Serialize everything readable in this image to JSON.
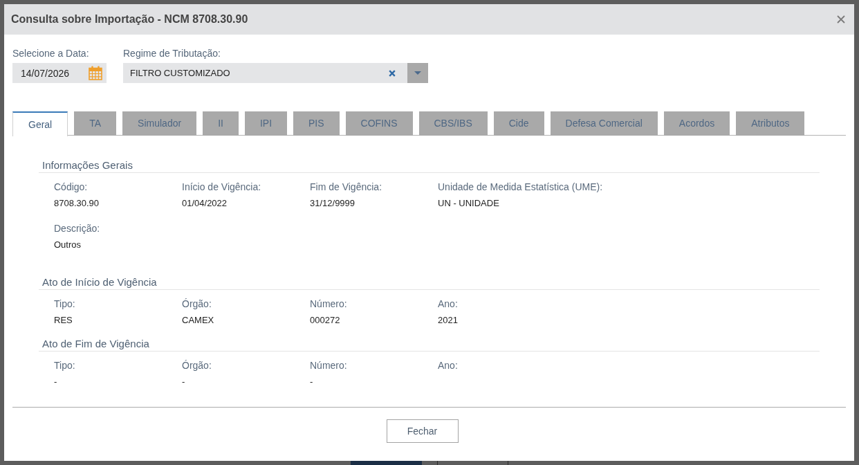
{
  "dialog": {
    "title": "Consulta sobre Importação - NCM 8708.30.90"
  },
  "filters": [
    {
      "kind": "date",
      "label": "Selecione a Data:",
      "value": "14/07/2026"
    },
    {
      "kind": "select",
      "label": "Regime de Tributação:",
      "value": "FILTRO CUSTOMIZADO"
    }
  ],
  "tabs": [
    {
      "label": "Geral",
      "selected": true
    },
    {
      "label": "TA",
      "selected": false
    },
    {
      "label": "Simulador",
      "selected": false
    },
    {
      "label": "II",
      "selected": false
    },
    {
      "label": "IPI",
      "selected": false
    },
    {
      "label": "PIS",
      "selected": false
    },
    {
      "label": "COFINS",
      "selected": false
    },
    {
      "label": "CBS/IBS",
      "selected": false
    },
    {
      "label": "Cide",
      "selected": false
    },
    {
      "label": "Defesa Comercial",
      "selected": false
    },
    {
      "label": "Acordos",
      "selected": false
    },
    {
      "label": "Atributos",
      "selected": false
    }
  ],
  "sections": [
    {
      "title": "Informações Gerais",
      "rows": [
        {
          "fields": [
            {
              "label": "Código:",
              "value": "8708.30.90"
            },
            {
              "label": "Início de Vigência:",
              "value": "01/04/2022"
            },
            {
              "label": "Fim de Vigência:",
              "value": "31/12/9999"
            },
            {
              "label": "Unidade de Medida Estatística (UME):",
              "value": "UN - UNIDADE"
            }
          ]
        },
        {
          "fields": [
            {
              "label": "Descrição:",
              "value": "Outros"
            }
          ]
        }
      ]
    },
    {
      "title": "Ato de Início de Vigência",
      "rows": [
        {
          "fields": [
            {
              "label": "Tipo:",
              "value": "RES"
            },
            {
              "label": "Órgão:",
              "value": "CAMEX"
            },
            {
              "label": "Número:",
              "value": "000272"
            },
            {
              "label": "Ano:",
              "value": "2021"
            }
          ]
        }
      ]
    },
    {
      "title": "Ato de Fim de Vigência",
      "rows": [
        {
          "fields": [
            {
              "label": "Tipo:",
              "value": "-"
            },
            {
              "label": "Órgão:",
              "value": "-"
            },
            {
              "label": "Número:",
              "value": "-"
            },
            {
              "label": "Ano:"
            }
          ]
        }
      ]
    }
  ],
  "footer": {
    "buttons": [
      "Fechar"
    ]
  }
}
